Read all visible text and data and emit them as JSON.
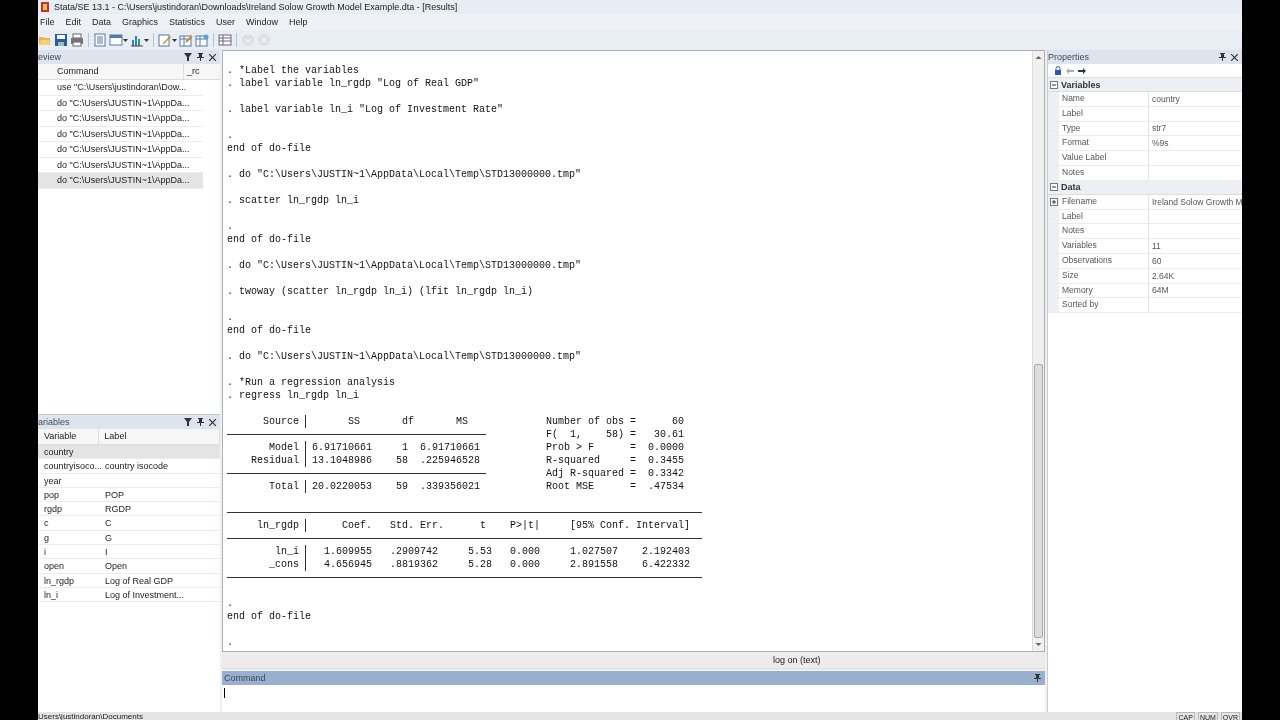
{
  "window": {
    "title": "Stata/SE 13.1 - C:\\Users\\justindoran\\Downloads\\Ireland Solow Growth Model Example.dta - [Results]"
  },
  "menu": [
    "File",
    "Edit",
    "Data",
    "Graphics",
    "Statistics",
    "User",
    "Window",
    "Help"
  ],
  "toolbar": [
    {
      "kind": "open",
      "dropdown": false,
      "disabled": false
    },
    {
      "kind": "save",
      "dropdown": false,
      "disabled": false
    },
    {
      "kind": "print",
      "dropdown": false,
      "disabled": false
    },
    {
      "kind": "sep"
    },
    {
      "kind": "log",
      "dropdown": false,
      "disabled": false
    },
    {
      "kind": "viewer",
      "dropdown": true,
      "disabled": false
    },
    {
      "kind": "graph",
      "dropdown": true,
      "disabled": false
    },
    {
      "kind": "sep"
    },
    {
      "kind": "editor",
      "dropdown": true,
      "disabled": false
    },
    {
      "kind": "data-editor",
      "dropdown": false,
      "disabled": false
    },
    {
      "kind": "data-browser",
      "dropdown": false,
      "disabled": false
    },
    {
      "kind": "sep"
    },
    {
      "kind": "variables",
      "dropdown": false,
      "disabled": false
    },
    {
      "kind": "sep"
    },
    {
      "kind": "more",
      "dropdown": false,
      "disabled": true
    },
    {
      "kind": "break",
      "dropdown": false,
      "disabled": true
    }
  ],
  "review": {
    "title": "eview",
    "columns": [
      "Command",
      "_rc"
    ],
    "items": [
      {
        "command": "use \"C:\\Users\\justindoran\\Dow...",
        "selected": false
      },
      {
        "command": "do \"C:\\Users\\JUSTIN~1\\AppDa...",
        "selected": false
      },
      {
        "command": "do \"C:\\Users\\JUSTIN~1\\AppDa...",
        "selected": false
      },
      {
        "command": "do \"C:\\Users\\JUSTIN~1\\AppDa...",
        "selected": false
      },
      {
        "command": "do \"C:\\Users\\JUSTIN~1\\AppDa...",
        "selected": false
      },
      {
        "command": "do \"C:\\Users\\JUSTIN~1\\AppDa...",
        "selected": false
      },
      {
        "command": "do \"C:\\Users\\JUSTIN~1\\AppDa...",
        "selected": true
      }
    ]
  },
  "variables": {
    "title": "ariables",
    "columns": [
      "Variable",
      "Label"
    ],
    "items": [
      {
        "name": "country",
        "selected": true
      },
      {
        "name": "countryisoco...",
        "label": "country isocode",
        "selected": false
      },
      {
        "name": "year",
        "selected": false
      },
      {
        "name": "pop",
        "label": "POP",
        "selected": false
      },
      {
        "name": "rgdp",
        "label": "RGDP",
        "selected": false
      },
      {
        "name": "c",
        "label": "C",
        "selected": false
      },
      {
        "name": "g",
        "label": "G",
        "selected": false
      },
      {
        "name": "i",
        "label": "I",
        "selected": false
      },
      {
        "name": "open",
        "label": "Open",
        "selected": false
      },
      {
        "name": "ln_rgdp",
        "label": "Log of Real GDP",
        "selected": false
      },
      {
        "name": "ln_i",
        "label": "Log of Investment...",
        "selected": false
      }
    ]
  },
  "results": [
    {
      "kind": "text",
      "text": ". *Label the variables"
    },
    {
      "kind": "text",
      "text": ". label variable ln_rgdp \"Log of Real GDP\""
    },
    {
      "kind": "blank"
    },
    {
      "kind": "text",
      "text": ". label variable ln_i \"Log of Investment Rate\""
    },
    {
      "kind": "blank"
    },
    {
      "kind": "text",
      "text": "."
    },
    {
      "kind": "text",
      "text": "end of do-file"
    },
    {
      "kind": "blank"
    },
    {
      "kind": "text",
      "text": ". do \"C:\\Users\\JUSTIN~1\\AppData\\Local\\Temp\\STD13000000.tmp\""
    },
    {
      "kind": "blank"
    },
    {
      "kind": "text",
      "text": ". scatter ln_rgdp ln_i"
    },
    {
      "kind": "blank"
    },
    {
      "kind": "text",
      "text": "."
    },
    {
      "kind": "text",
      "text": "end of do-file"
    },
    {
      "kind": "blank"
    },
    {
      "kind": "text",
      "text": ". do \"C:\\Users\\JUSTIN~1\\AppData\\Local\\Temp\\STD13000000.tmp\""
    },
    {
      "kind": "blank"
    },
    {
      "kind": "text",
      "text": ". twoway (scatter ln_rgdp ln_i) (lfit ln_rgdp ln_i)"
    },
    {
      "kind": "blank"
    },
    {
      "kind": "text",
      "text": "."
    },
    {
      "kind": "text",
      "text": "end of do-file"
    },
    {
      "kind": "blank"
    },
    {
      "kind": "text",
      "text": ". do \"C:\\Users\\JUSTIN~1\\AppData\\Local\\Temp\\STD13000000.tmp\""
    },
    {
      "kind": "blank"
    },
    {
      "kind": "text",
      "text": ". *Run a regression analysis"
    },
    {
      "kind": "text",
      "text": ". regress ln_rgdp ln_i"
    },
    {
      "kind": "blank"
    },
    {
      "kind": "anova",
      "rows": [
        {
          "rule": false,
          "label": "Source",
          "cells": "       SS       df       MS",
          "stat": "Number of obs =      60"
        },
        {
          "rule": true,
          "stat": "F(  1,    58) =   30.61"
        },
        {
          "rule": false,
          "label": "Model",
          "cells": " 6.91710661     1  6.91710661",
          "stat": "Prob > F      =  0.0000"
        },
        {
          "rule": false,
          "label": "Residual",
          "cells": " 13.1048986    58  .225946528",
          "stat": "R-squared     =  0.3455"
        },
        {
          "rule": true,
          "stat": "Adj R-squared =  0.3342"
        },
        {
          "rule": false,
          "label": "Total",
          "cells": " 20.0220053    59  .339356021",
          "stat": "Root MSE      =  .47534"
        }
      ]
    },
    {
      "kind": "blank"
    },
    {
      "kind": "coef",
      "rows": [
        {
          "rule": true
        },
        {
          "rule": false,
          "label": "ln_rgdp",
          "cells": "      Coef.   Std. Err.      t    P>|t|     [95% Conf. Interval]"
        },
        {
          "rule": true
        },
        {
          "rule": false,
          "label": "ln_i",
          "cells": "   1.609955   .2909742     5.53   0.000     1.027507    2.192403"
        },
        {
          "rule": false,
          "label": "_cons",
          "cells": "   4.656945   .8819362     5.28   0.000     2.891558    6.422332"
        },
        {
          "rule": true
        }
      ]
    },
    {
      "kind": "blank"
    },
    {
      "kind": "text",
      "text": "."
    },
    {
      "kind": "text",
      "text": "end of do-file"
    },
    {
      "kind": "blank"
    },
    {
      "kind": "text",
      "text": "."
    }
  ],
  "results_status": "log on (text)",
  "command": {
    "title": "Command"
  },
  "properties": {
    "title": "Properties",
    "sections": [
      {
        "title": "Variables",
        "expanded": true,
        "rows": [
          {
            "name": "Name",
            "value": "country",
            "expandable": false
          },
          {
            "name": "Label",
            "expandable": false
          },
          {
            "name": "Type",
            "value": "str7",
            "expandable": false
          },
          {
            "name": "Format",
            "value": "%9s",
            "expandable": false
          },
          {
            "name": "Value Label",
            "expandable": false
          },
          {
            "name": "Notes",
            "expandable": false
          }
        ]
      },
      {
        "title": "Data",
        "expanded": true,
        "rows": [
          {
            "name": "Filename",
            "value": "Ireland Solow Growth M",
            "expandable": true
          },
          {
            "name": "Label",
            "expandable": false
          },
          {
            "name": "Notes",
            "expandable": false
          },
          {
            "name": "Variables",
            "value": "11",
            "expandable": false
          },
          {
            "name": "Observations",
            "value": "60",
            "expandable": false
          },
          {
            "name": "Size",
            "value": "2.64K",
            "expandable": false
          },
          {
            "name": "Memory",
            "value": "64M",
            "expandable": false
          },
          {
            "name": "Sorted by",
            "expandable": false
          }
        ]
      }
    ]
  },
  "status_bar": {
    "path": "Users\\justindoran\\Documents",
    "indicators": [
      "CAP",
      "NUM",
      "OVR"
    ]
  }
}
